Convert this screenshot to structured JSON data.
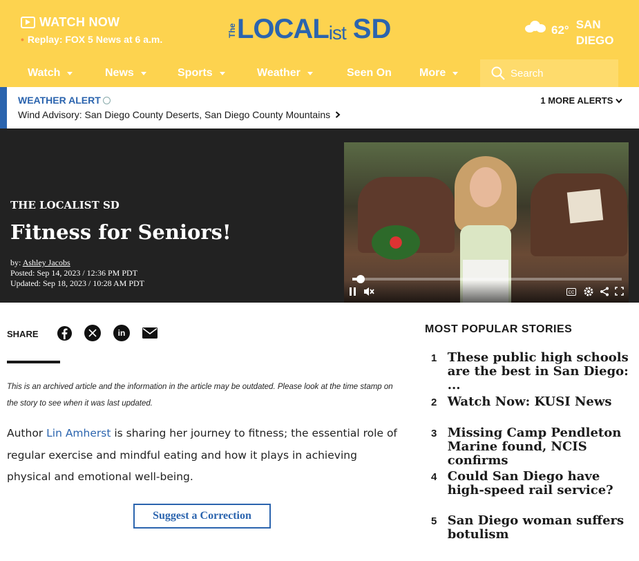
{
  "header": {
    "watch_now": "WATCH NOW",
    "replay": "Replay: FOX 5 News at 6 a.m.",
    "logo_the": "The",
    "logo_main": "LOCAL",
    "logo_ist": "ist",
    "logo_sd": "SD",
    "temperature": "62°",
    "city_line1": "SAN",
    "city_line2": "DIEGO"
  },
  "nav": {
    "items": [
      {
        "label": "Watch",
        "has_dropdown": true
      },
      {
        "label": "News",
        "has_dropdown": true
      },
      {
        "label": "Sports",
        "has_dropdown": true
      },
      {
        "label": "Weather",
        "has_dropdown": true
      },
      {
        "label": "Seen On",
        "has_dropdown": false
      },
      {
        "label": "More",
        "has_dropdown": true
      }
    ],
    "search_placeholder": "Search"
  },
  "alert": {
    "title": "WEATHER ALERT",
    "message": "Wind Advisory: San Diego County Deserts, San Diego County Mountains",
    "more": "1 MORE ALERTS"
  },
  "hero": {
    "kicker": "THE LOCALIST SD",
    "headline": "Fitness for Seniors!",
    "byline_prefix": "by:",
    "author": "Ashley Jacobs",
    "posted": "Posted: Sep 14, 2023 / 12:36 PM PDT",
    "updated": "Updated: Sep 18, 2023 / 10:28 AM PDT",
    "video_progress": 0.03
  },
  "article": {
    "share_label": "SHARE",
    "archived_note": "This is an archived article and the information in the article may be outdated. Please look at the time stamp on the story to see when it was last updated.",
    "body_prefix": "Author ",
    "body_link": "Lin Amherst",
    "body_suffix": " is sharing her journey to fitness; the essential role of regular exercise and mindful eating and how it plays in achieving physical and emotional well-being.",
    "suggest_correction": "Suggest a Correction"
  },
  "popular": {
    "title": "MOST POPULAR STORIES",
    "items": [
      {
        "num": "1",
        "text": "These public high schools are the best in San Diego: ..."
      },
      {
        "num": "2",
        "text": "Watch Now: KUSI News"
      },
      {
        "num": "3",
        "text": "Missing Camp Pendleton Marine found, NCIS confirms"
      },
      {
        "num": "4",
        "text": "Could San Diego have high-speed rail service?"
      },
      {
        "num": "5",
        "text": "San Diego woman suffers botulism"
      }
    ]
  },
  "colors": {
    "header_bg": "#fdd34f",
    "brand_blue": "#2b64ae",
    "hero_bg": "#222222"
  }
}
